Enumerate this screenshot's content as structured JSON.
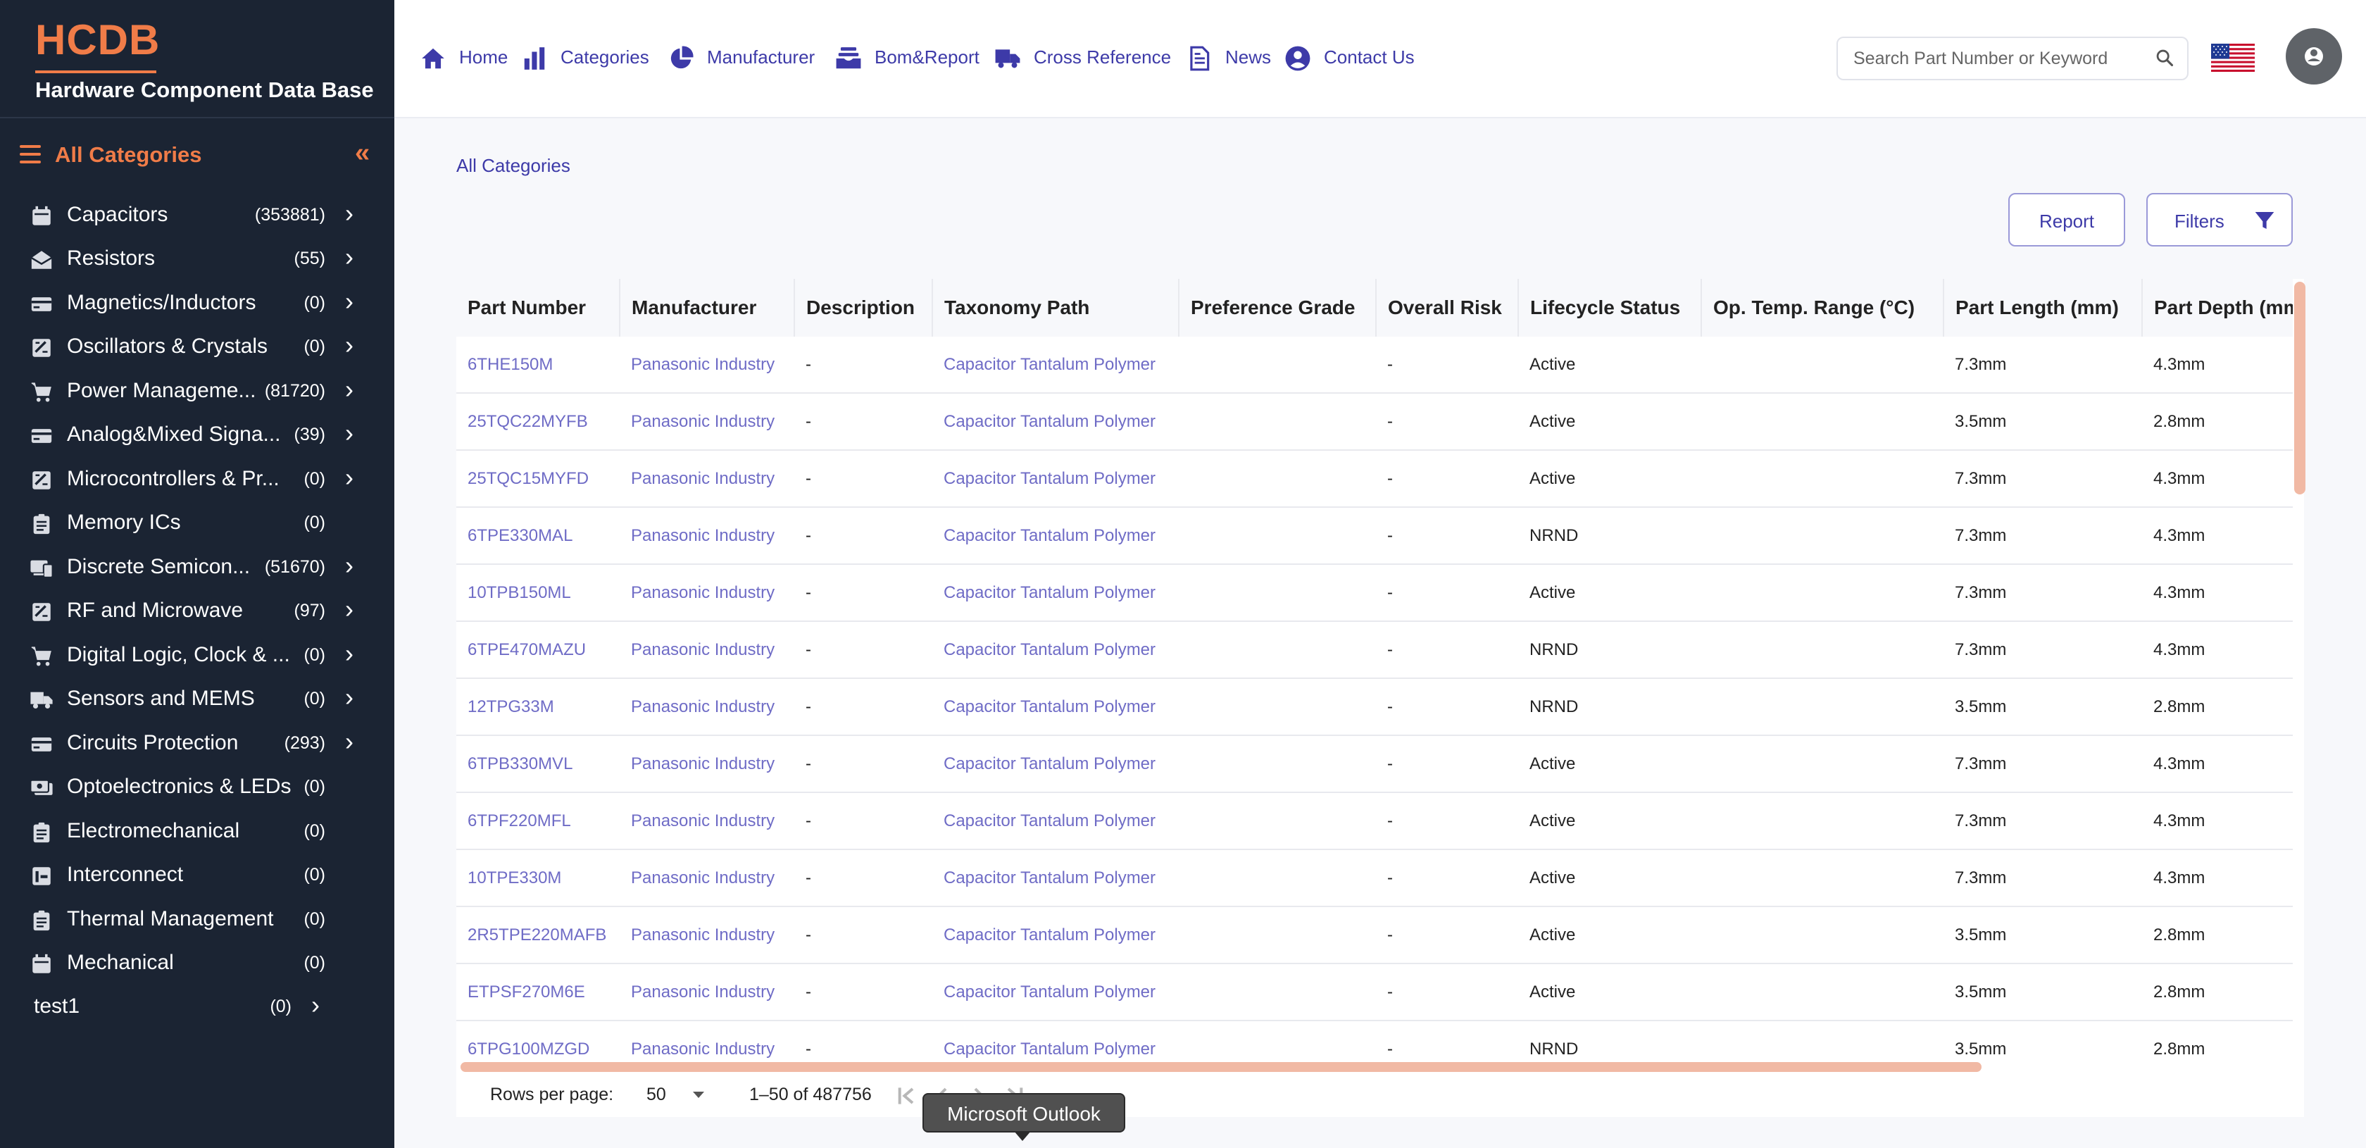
{
  "brand": {
    "logo": "HCDB",
    "subtitle": "Hardware Component Data Base"
  },
  "sidebar": {
    "all_categories_label": "All Categories",
    "collapse_glyph": "«",
    "chevron_glyph": "›",
    "items": [
      {
        "label": "Capacitors",
        "count": "(353881)",
        "icon": "calendar-icon",
        "has_chevron": true
      },
      {
        "label": "Resistors",
        "count": "(55)",
        "icon": "drafts-icon",
        "has_chevron": true
      },
      {
        "label": "Magnetics/Inductors",
        "count": "(0)",
        "icon": "credit-card-icon",
        "has_chevron": true
      },
      {
        "label": "Oscillators & Crystals",
        "count": "(0)",
        "icon": "assessment-icon",
        "has_chevron": true
      },
      {
        "label": "Power Manageme...",
        "count": "(81720)",
        "icon": "cart-icon",
        "has_chevron": true
      },
      {
        "label": "Analog&Mixed Signa...",
        "count": "(39)",
        "icon": "credit-card-icon",
        "has_chevron": true
      },
      {
        "label": "Microcontrollers & Pr...",
        "count": "(0)",
        "icon": "assessment-icon",
        "has_chevron": true
      },
      {
        "label": "Memory ICs",
        "count": "(0)",
        "icon": "assignment-icon",
        "has_chevron": false
      },
      {
        "label": "Discrete Semicon...",
        "count": "(51670)",
        "icon": "devices-icon",
        "has_chevron": true
      },
      {
        "label": "RF and Microwave",
        "count": "(97)",
        "icon": "assessment-icon",
        "has_chevron": true
      },
      {
        "label": "Digital Logic, Clock & ...",
        "count": "(0)",
        "icon": "cart-icon",
        "has_chevron": true
      },
      {
        "label": "Sensors and MEMS",
        "count": "(0)",
        "icon": "truck-icon",
        "has_chevron": true
      },
      {
        "label": "Circuits Protection",
        "count": "(293)",
        "icon": "credit-card-icon",
        "has_chevron": true
      },
      {
        "label": "Optoelectronics & LEDs",
        "count": "(0)",
        "icon": "money-icon",
        "has_chevron": false
      },
      {
        "label": "Electromechanical",
        "count": "(0)",
        "icon": "assignment-icon",
        "has_chevron": false
      },
      {
        "label": "Interconnect",
        "count": "(0)",
        "icon": "chart-icon",
        "has_chevron": false
      },
      {
        "label": "Thermal Management",
        "count": "(0)",
        "icon": "assignment-icon",
        "has_chevron": false
      },
      {
        "label": "Mechanical",
        "count": "(0)",
        "icon": "calendar-icon",
        "has_chevron": false
      },
      {
        "label": "test1",
        "count": "(0)",
        "icon": "",
        "has_chevron": true
      }
    ]
  },
  "nav": [
    {
      "label": "Home",
      "icon": "home-icon"
    },
    {
      "label": "Categories",
      "icon": "bar-chart-icon"
    },
    {
      "label": "Manufacturer",
      "icon": "pie-chart-icon"
    },
    {
      "label": "Bom&Report",
      "icon": "inbox-stack-icon"
    },
    {
      "label": "Cross Reference",
      "icon": "truck-icon"
    },
    {
      "label": "News",
      "icon": "document-icon"
    },
    {
      "label": "Contact Us",
      "icon": "account-circle-icon"
    }
  ],
  "search": {
    "placeholder": "Search Part Number or Keyword"
  },
  "breadcrumb": "All Categories",
  "actions": {
    "report_label": "Report",
    "filters_label": "Filters"
  },
  "table": {
    "columns": [
      "Part Number",
      "Manufacturer",
      "Description",
      "Taxonomy Path",
      "Preference Grade",
      "Overall Risk",
      "Lifecycle Status",
      "Op. Temp. Range (°C)",
      "Part Length (mm)",
      "Part Depth (mm)"
    ],
    "rows": [
      [
        "6THE150M",
        "Panasonic Industry",
        "-",
        "Capacitor Tantalum Polymer",
        "",
        "-",
        "Active",
        "",
        "7.3mm",
        "4.3mm"
      ],
      [
        "25TQC22MYFB",
        "Panasonic Industry",
        "-",
        "Capacitor Tantalum Polymer",
        "",
        "-",
        "Active",
        "",
        "3.5mm",
        "2.8mm"
      ],
      [
        "25TQC15MYFD",
        "Panasonic Industry",
        "-",
        "Capacitor Tantalum Polymer",
        "",
        "-",
        "Active",
        "",
        "7.3mm",
        "4.3mm"
      ],
      [
        "6TPE330MAL",
        "Panasonic Industry",
        "-",
        "Capacitor Tantalum Polymer",
        "",
        "-",
        "NRND",
        "",
        "7.3mm",
        "4.3mm"
      ],
      [
        "10TPB150ML",
        "Panasonic Industry",
        "-",
        "Capacitor Tantalum Polymer",
        "",
        "-",
        "Active",
        "",
        "7.3mm",
        "4.3mm"
      ],
      [
        "6TPE470MAZU",
        "Panasonic Industry",
        "-",
        "Capacitor Tantalum Polymer",
        "",
        "-",
        "NRND",
        "",
        "7.3mm",
        "4.3mm"
      ],
      [
        "12TPG33M",
        "Panasonic Industry",
        "-",
        "Capacitor Tantalum Polymer",
        "",
        "-",
        "NRND",
        "",
        "3.5mm",
        "2.8mm"
      ],
      [
        "6TPB330MVL",
        "Panasonic Industry",
        "-",
        "Capacitor Tantalum Polymer",
        "",
        "-",
        "Active",
        "",
        "7.3mm",
        "4.3mm"
      ],
      [
        "6TPF220MFL",
        "Panasonic Industry",
        "-",
        "Capacitor Tantalum Polymer",
        "",
        "-",
        "Active",
        "",
        "7.3mm",
        "4.3mm"
      ],
      [
        "10TPE330M",
        "Panasonic Industry",
        "-",
        "Capacitor Tantalum Polymer",
        "",
        "-",
        "Active",
        "",
        "7.3mm",
        "4.3mm"
      ],
      [
        "2R5TPE220MAFB",
        "Panasonic Industry",
        "-",
        "Capacitor Tantalum Polymer",
        "",
        "-",
        "Active",
        "",
        "3.5mm",
        "2.8mm"
      ],
      [
        "ETPSF270M6E",
        "Panasonic Industry",
        "-",
        "Capacitor Tantalum Polymer",
        "",
        "-",
        "Active",
        "",
        "3.5mm",
        "2.8mm"
      ],
      [
        "6TPG100MZGD",
        "Panasonic Industry",
        "-",
        "Capacitor Tantalum Polymer",
        "",
        "-",
        "NRND",
        "",
        "3.5mm",
        "2.8mm"
      ]
    ]
  },
  "pagination": {
    "rows_per_page_label": "Rows per page:",
    "rows_per_page": "50",
    "range": "1–50 of 487756"
  },
  "tooltip": "Microsoft Outlook",
  "colors": {
    "sidebar_bg": "#1b2433",
    "accent_orange": "#f07c48",
    "nav_blue": "#3d3aa8",
    "link_blue": "#6f6cc6",
    "scroll_thumb": "#f1b9a4"
  }
}
